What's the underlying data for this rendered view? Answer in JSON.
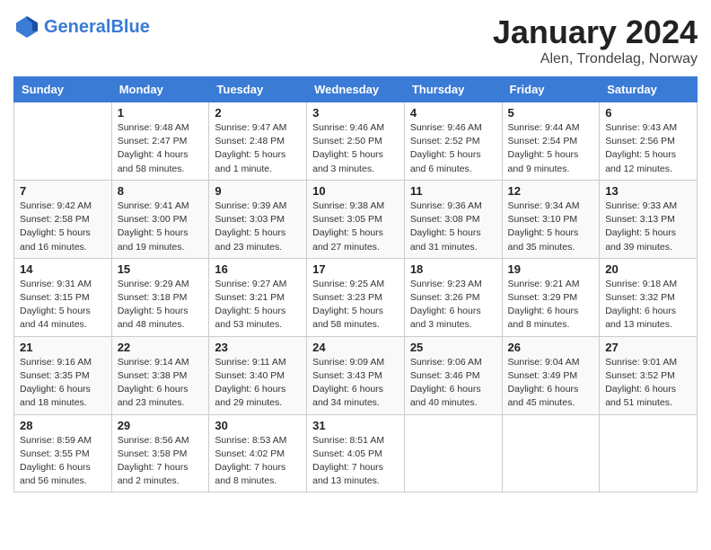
{
  "header": {
    "logo_line1": "General",
    "logo_line2": "Blue",
    "month_title": "January 2024",
    "subtitle": "Alen, Trondelag, Norway"
  },
  "weekdays": [
    "Sunday",
    "Monday",
    "Tuesday",
    "Wednesday",
    "Thursday",
    "Friday",
    "Saturday"
  ],
  "weeks": [
    [
      {
        "day": "",
        "info": ""
      },
      {
        "day": "1",
        "info": "Sunrise: 9:48 AM\nSunset: 2:47 PM\nDaylight: 4 hours\nand 58 minutes."
      },
      {
        "day": "2",
        "info": "Sunrise: 9:47 AM\nSunset: 2:48 PM\nDaylight: 5 hours\nand 1 minute."
      },
      {
        "day": "3",
        "info": "Sunrise: 9:46 AM\nSunset: 2:50 PM\nDaylight: 5 hours\nand 3 minutes."
      },
      {
        "day": "4",
        "info": "Sunrise: 9:46 AM\nSunset: 2:52 PM\nDaylight: 5 hours\nand 6 minutes."
      },
      {
        "day": "5",
        "info": "Sunrise: 9:44 AM\nSunset: 2:54 PM\nDaylight: 5 hours\nand 9 minutes."
      },
      {
        "day": "6",
        "info": "Sunrise: 9:43 AM\nSunset: 2:56 PM\nDaylight: 5 hours\nand 12 minutes."
      }
    ],
    [
      {
        "day": "7",
        "info": "Sunrise: 9:42 AM\nSunset: 2:58 PM\nDaylight: 5 hours\nand 16 minutes."
      },
      {
        "day": "8",
        "info": "Sunrise: 9:41 AM\nSunset: 3:00 PM\nDaylight: 5 hours\nand 19 minutes."
      },
      {
        "day": "9",
        "info": "Sunrise: 9:39 AM\nSunset: 3:03 PM\nDaylight: 5 hours\nand 23 minutes."
      },
      {
        "day": "10",
        "info": "Sunrise: 9:38 AM\nSunset: 3:05 PM\nDaylight: 5 hours\nand 27 minutes."
      },
      {
        "day": "11",
        "info": "Sunrise: 9:36 AM\nSunset: 3:08 PM\nDaylight: 5 hours\nand 31 minutes."
      },
      {
        "day": "12",
        "info": "Sunrise: 9:34 AM\nSunset: 3:10 PM\nDaylight: 5 hours\nand 35 minutes."
      },
      {
        "day": "13",
        "info": "Sunrise: 9:33 AM\nSunset: 3:13 PM\nDaylight: 5 hours\nand 39 minutes."
      }
    ],
    [
      {
        "day": "14",
        "info": "Sunrise: 9:31 AM\nSunset: 3:15 PM\nDaylight: 5 hours\nand 44 minutes."
      },
      {
        "day": "15",
        "info": "Sunrise: 9:29 AM\nSunset: 3:18 PM\nDaylight: 5 hours\nand 48 minutes."
      },
      {
        "day": "16",
        "info": "Sunrise: 9:27 AM\nSunset: 3:21 PM\nDaylight: 5 hours\nand 53 minutes."
      },
      {
        "day": "17",
        "info": "Sunrise: 9:25 AM\nSunset: 3:23 PM\nDaylight: 5 hours\nand 58 minutes."
      },
      {
        "day": "18",
        "info": "Sunrise: 9:23 AM\nSunset: 3:26 PM\nDaylight: 6 hours\nand 3 minutes."
      },
      {
        "day": "19",
        "info": "Sunrise: 9:21 AM\nSunset: 3:29 PM\nDaylight: 6 hours\nand 8 minutes."
      },
      {
        "day": "20",
        "info": "Sunrise: 9:18 AM\nSunset: 3:32 PM\nDaylight: 6 hours\nand 13 minutes."
      }
    ],
    [
      {
        "day": "21",
        "info": "Sunrise: 9:16 AM\nSunset: 3:35 PM\nDaylight: 6 hours\nand 18 minutes."
      },
      {
        "day": "22",
        "info": "Sunrise: 9:14 AM\nSunset: 3:38 PM\nDaylight: 6 hours\nand 23 minutes."
      },
      {
        "day": "23",
        "info": "Sunrise: 9:11 AM\nSunset: 3:40 PM\nDaylight: 6 hours\nand 29 minutes."
      },
      {
        "day": "24",
        "info": "Sunrise: 9:09 AM\nSunset: 3:43 PM\nDaylight: 6 hours\nand 34 minutes."
      },
      {
        "day": "25",
        "info": "Sunrise: 9:06 AM\nSunset: 3:46 PM\nDaylight: 6 hours\nand 40 minutes."
      },
      {
        "day": "26",
        "info": "Sunrise: 9:04 AM\nSunset: 3:49 PM\nDaylight: 6 hours\nand 45 minutes."
      },
      {
        "day": "27",
        "info": "Sunrise: 9:01 AM\nSunset: 3:52 PM\nDaylight: 6 hours\nand 51 minutes."
      }
    ],
    [
      {
        "day": "28",
        "info": "Sunrise: 8:59 AM\nSunset: 3:55 PM\nDaylight: 6 hours\nand 56 minutes."
      },
      {
        "day": "29",
        "info": "Sunrise: 8:56 AM\nSunset: 3:58 PM\nDaylight: 7 hours\nand 2 minutes."
      },
      {
        "day": "30",
        "info": "Sunrise: 8:53 AM\nSunset: 4:02 PM\nDaylight: 7 hours\nand 8 minutes."
      },
      {
        "day": "31",
        "info": "Sunrise: 8:51 AM\nSunset: 4:05 PM\nDaylight: 7 hours\nand 13 minutes."
      },
      {
        "day": "",
        "info": ""
      },
      {
        "day": "",
        "info": ""
      },
      {
        "day": "",
        "info": ""
      }
    ]
  ]
}
